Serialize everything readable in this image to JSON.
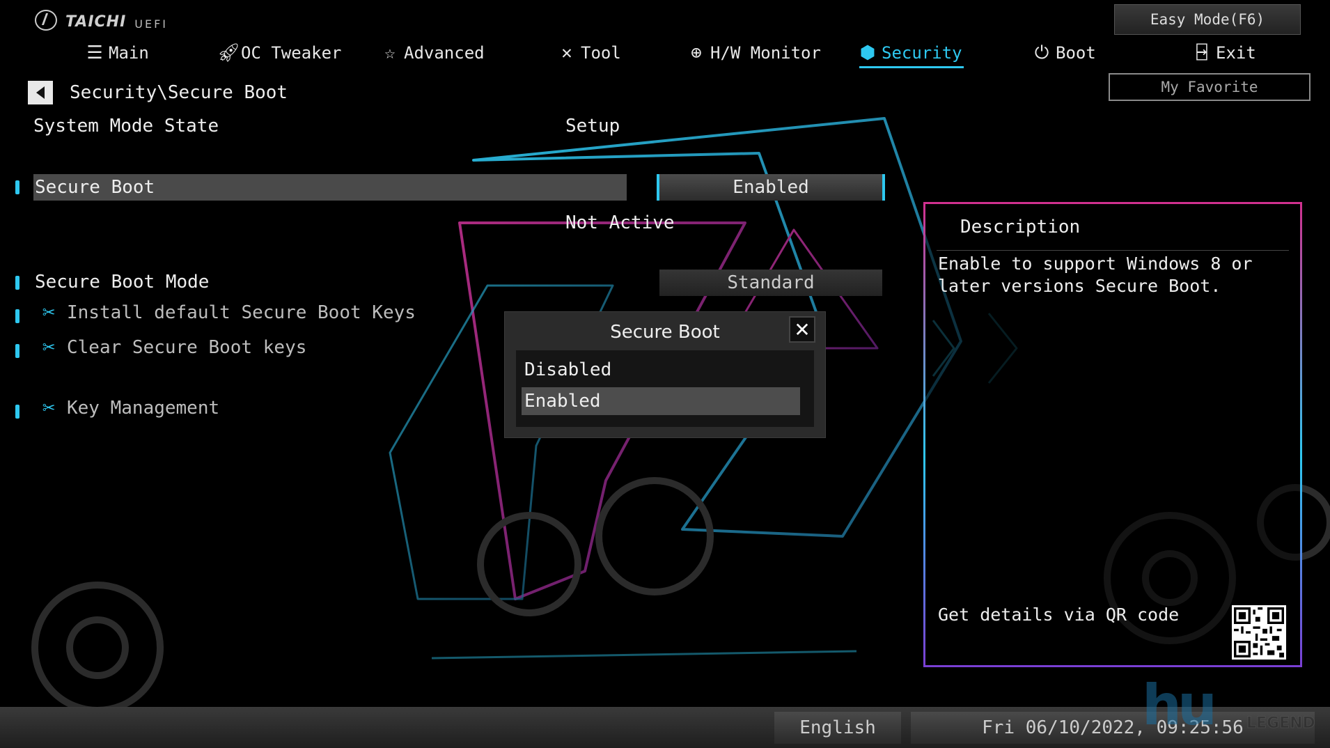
{
  "header": {
    "brand": "TAICHI",
    "product": "UEFI",
    "easy_mode_label": "Easy Mode(F6)",
    "my_favorite_label": "My Favorite"
  },
  "tabs": [
    {
      "label": "Main",
      "icon": "list-icon"
    },
    {
      "label": "OC Tweaker",
      "icon": "rocket-icon"
    },
    {
      "label": "Advanced",
      "icon": "star-icon"
    },
    {
      "label": "Tool",
      "icon": "tools-icon"
    },
    {
      "label": "H/W Monitor",
      "icon": "monitor-icon"
    },
    {
      "label": "Security",
      "icon": "shield-icon",
      "active": true
    },
    {
      "label": "Boot",
      "icon": "power-icon"
    },
    {
      "label": "Exit",
      "icon": "exit-icon"
    }
  ],
  "breadcrumb": "Security\\Secure Boot",
  "settings": {
    "system_mode_state": {
      "label": "System Mode State",
      "value": "Setup"
    },
    "secure_boot": {
      "label": "Secure Boot",
      "value": "Enabled",
      "status": "Not Active"
    },
    "secure_boot_mode": {
      "label": "Secure Boot Mode",
      "value": "Standard"
    },
    "install_default_keys": {
      "label": "Install default Secure Boot Keys"
    },
    "clear_keys": {
      "label": "Clear Secure Boot keys"
    },
    "key_management": {
      "label": "Key Management"
    }
  },
  "popup": {
    "title": "Secure Boot",
    "options": [
      "Disabled",
      "Enabled"
    ],
    "selected": "Enabled"
  },
  "description": {
    "title": "Description",
    "text": "Enable to support Windows 8 or later versions Secure Boot.",
    "qr_label": "Get details via QR code"
  },
  "footer": {
    "language": "English",
    "datetime": "Fri 06/10/2022, 09:25:56"
  },
  "watermark": {
    "big": "hu",
    "small": "LEGEND"
  },
  "colors": {
    "accent": "#2ec8f0",
    "magenta": "#d0308f",
    "background": "#000000"
  }
}
